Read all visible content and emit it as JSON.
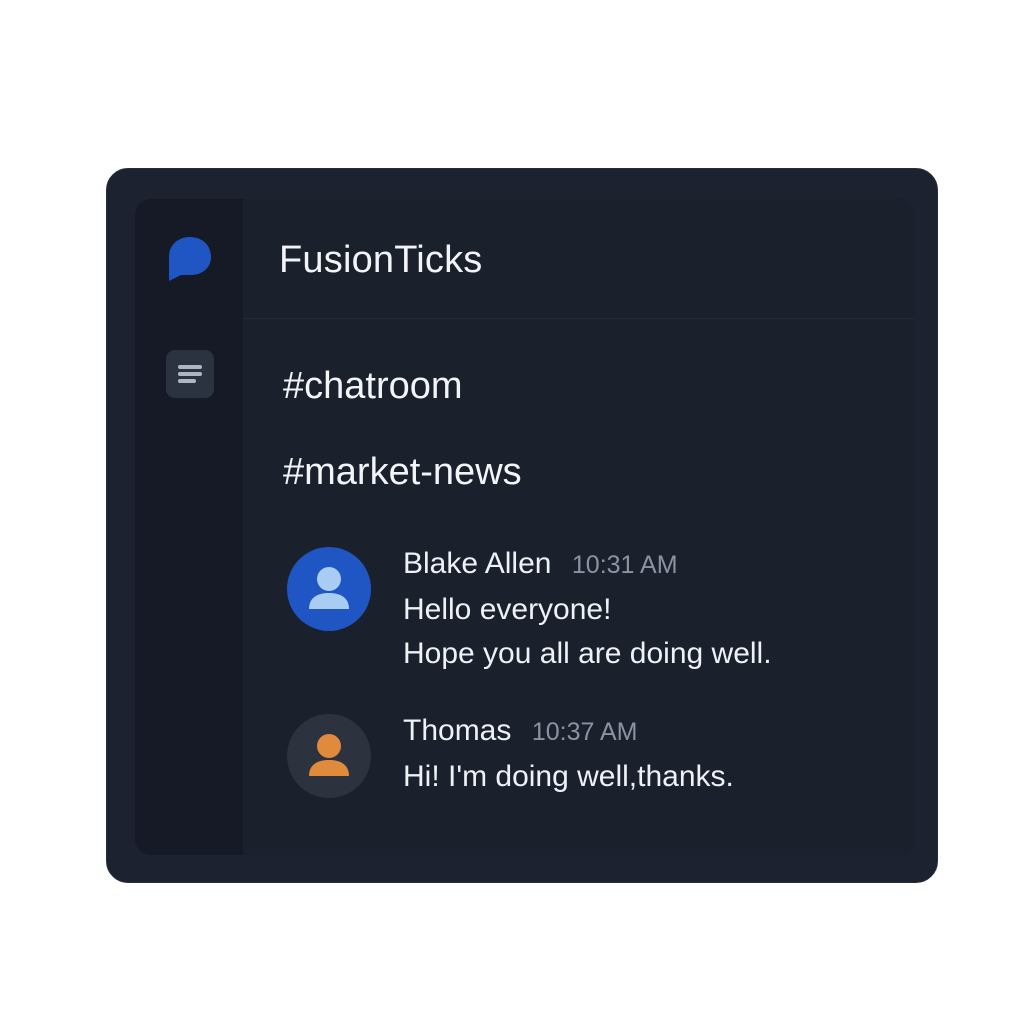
{
  "app": {
    "title": "FusionTicks"
  },
  "sidebar": {
    "logo_icon": "chat-bubble-logo-icon",
    "menu_icon": "menu-lines-icon"
  },
  "channels": [
    {
      "label": "#chatroom"
    },
    {
      "label": "#market-news"
    }
  ],
  "messages": [
    {
      "author": "Blake Allen",
      "time": "10:31 AM",
      "avatar_icon": "user-icon",
      "avatar_color": "#1f56c4",
      "lines": [
        "Hello everyone!",
        "Hope you all are doing well."
      ]
    },
    {
      "author": "Thomas",
      "time": "10:37 AM",
      "avatar_icon": "user-icon",
      "avatar_color": "#e08a3c",
      "lines": [
        "Hi! I'm doing well,thanks."
      ]
    }
  ],
  "colors": {
    "accent": "#1f56c4",
    "background": "#1a202c",
    "sidebar": "#151a26"
  }
}
